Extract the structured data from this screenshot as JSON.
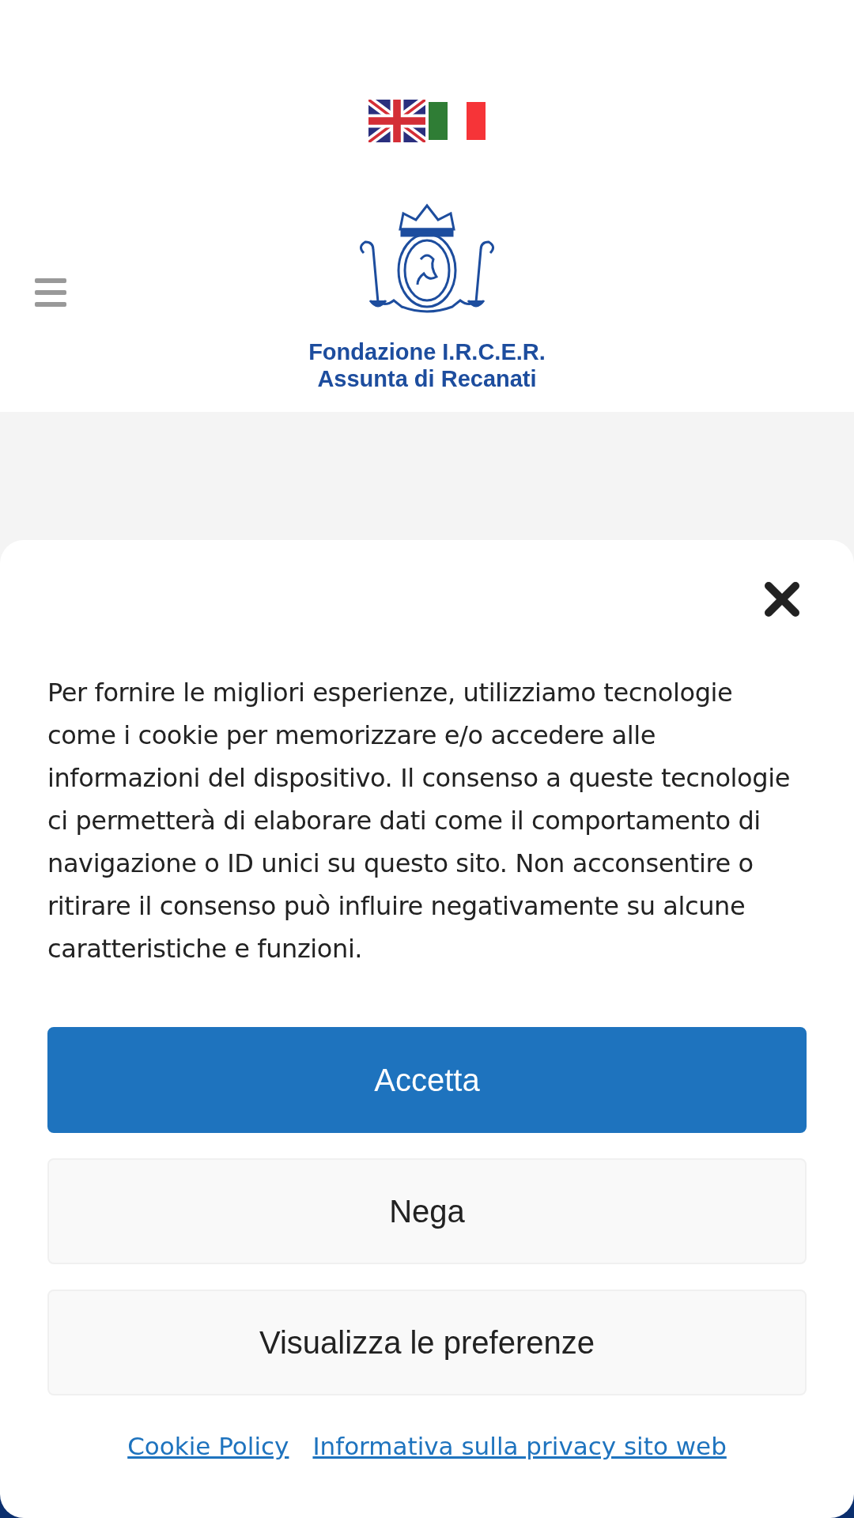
{
  "header": {
    "languages": [
      {
        "kind": "uk"
      },
      {
        "kind": "it"
      }
    ],
    "logo": {
      "lines": [
        "Fondazione I.R.C.E.R.",
        "Assunta di Recanati"
      ]
    }
  },
  "cookie_banner": {
    "text": "Per fornire le migliori esperienze, utilizziamo tecnologie come i cookie per memorizzare e/o accedere alle informazioni del dispositivo. Il consenso a queste tecnologie ci permetterà di elaborare dati come il comportamento di navigazione o ID unici su questo sito. Non acconsentire o ritirare il consenso può influire negativamente su alcune caratteristiche e funzioni.",
    "buttons": [
      {
        "label": "Accetta",
        "kind": "primary"
      },
      {
        "label": "Nega",
        "kind": "secondary"
      },
      {
        "label": "Visualizza le preferenze",
        "kind": "secondary"
      }
    ],
    "links": [
      "Cookie Policy",
      "Informativa sulla privacy sito web"
    ]
  }
}
